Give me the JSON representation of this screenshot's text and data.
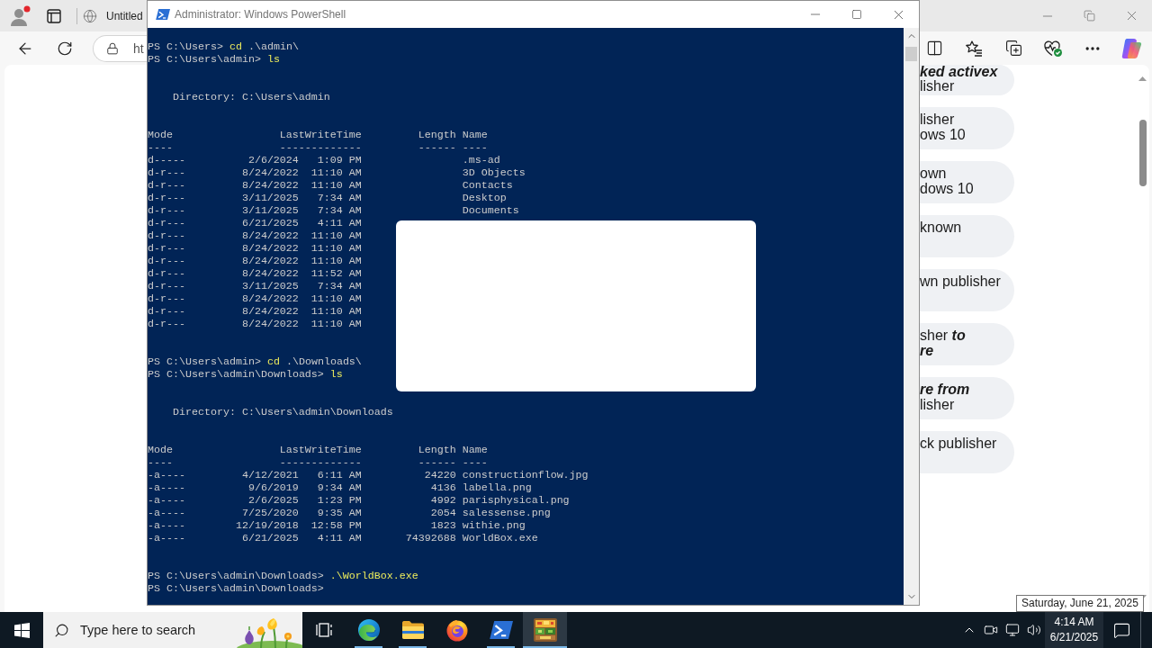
{
  "browser": {
    "tab": {
      "title": "Untitled"
    },
    "address_bar": {
      "value": "ht"
    },
    "page_cards": [
      {
        "text": "**ked activex**\nlisher"
      },
      {
        "text": "lisher\nows 10"
      },
      {
        "text": "own\ndows 10"
      },
      {
        "text": "known"
      },
      {
        "text": "wn publisher"
      },
      {
        "text": "sher **to**\n**re**"
      },
      {
        "text": "**re from**\nlisher"
      },
      {
        "text": "ck publisher"
      }
    ]
  },
  "powershell": {
    "title": "Administrator: Windows PowerShell",
    "blocks": [
      {
        "kind": "command",
        "prompt": "PS C:\\Users>",
        "command": "cd",
        "argument": ".\\admin\\"
      },
      {
        "kind": "command",
        "prompt": "PS C:\\Users\\admin>",
        "command": "ls"
      },
      {
        "kind": "listing",
        "directory": "Directory: C:\\Users\\admin",
        "columns": [
          {
            "heading": "Mode",
            "rule": "----"
          },
          {
            "heading": "LastWriteTime",
            "rule": "-------------"
          },
          {
            "heading": "Length",
            "rule": "------"
          },
          {
            "heading": "Name",
            "rule": "----"
          }
        ],
        "rows": [
          {
            "mode": "d-----",
            "date": "2/6/2024",
            "time": "1:09 PM",
            "name": ".ms-ad"
          },
          {
            "mode": "d-r---",
            "date": "8/24/2022",
            "time": "11:10 AM",
            "name": "3D Objects"
          },
          {
            "mode": "d-r---",
            "date": "8/24/2022",
            "time": "11:10 AM",
            "name": "Contacts"
          },
          {
            "mode": "d-r---",
            "date": "3/11/2025",
            "time": "7:34 AM",
            "name": "Desktop"
          },
          {
            "mode": "d-r---",
            "date": "3/11/2025",
            "time": "7:34 AM",
            "name": "Documents"
          },
          {
            "mode": "d-r---",
            "date": "6/21/2025",
            "time": "4:11 AM"
          },
          {
            "mode": "d-r---",
            "date": "8/24/2022",
            "time": "11:10 AM"
          },
          {
            "mode": "d-r---",
            "date": "8/24/2022",
            "time": "11:10 AM"
          },
          {
            "mode": "d-r---",
            "date": "8/24/2022",
            "time": "11:10 AM"
          },
          {
            "mode": "d-r---",
            "date": "8/24/2022",
            "time": "11:52 AM"
          },
          {
            "mode": "d-r---",
            "date": "3/11/2025",
            "time": "7:34 AM"
          },
          {
            "mode": "d-r---",
            "date": "8/24/2022",
            "time": "11:10 AM"
          },
          {
            "mode": "d-r---",
            "date": "8/24/2022",
            "time": "11:10 AM"
          },
          {
            "mode": "d-r---",
            "date": "8/24/2022",
            "time": "11:10 AM"
          }
        ]
      },
      {
        "kind": "command",
        "prompt": "PS C:\\Users\\admin>",
        "command": "cd",
        "argument": ".\\Downloads\\"
      },
      {
        "kind": "command",
        "prompt": "PS C:\\Users\\admin\\Downloads>",
        "command": "ls"
      },
      {
        "kind": "listing",
        "directory": "Directory: C:\\Users\\admin\\Downloads",
        "columns": [
          {
            "heading": "Mode",
            "rule": "----"
          },
          {
            "heading": "LastWriteTime",
            "rule": "-------------"
          },
          {
            "heading": "Length",
            "rule": "------"
          },
          {
            "heading": "Name",
            "rule": "----"
          }
        ],
        "rows": [
          {
            "mode": "-a----",
            "date": "4/12/2021",
            "time": "6:11 AM",
            "length": "24220",
            "name": "constructionflow.jpg"
          },
          {
            "mode": "-a----",
            "date": "9/6/2019",
            "time": "9:34 AM",
            "length": "4136",
            "name": "labella.png"
          },
          {
            "mode": "-a----",
            "date": "2/6/2025",
            "time": "1:23 PM",
            "length": "4992",
            "name": "parisphysical.png"
          },
          {
            "mode": "-a----",
            "date": "7/25/2020",
            "time": "9:35 AM",
            "length": "2054",
            "name": "salessense.png"
          },
          {
            "mode": "-a----",
            "date": "12/19/2018",
            "time": "12:58 PM",
            "length": "1823",
            "name": "withie.png"
          },
          {
            "mode": "-a----",
            "date": "6/21/2025",
            "time": "4:11 AM",
            "length": "74392688",
            "name": "WorldBox.exe"
          }
        ]
      },
      {
        "kind": "command",
        "prompt": "PS C:\\Users\\admin\\Downloads>",
        "command": ".\\WorldBox.exe"
      },
      {
        "kind": "command",
        "prompt": "PS C:\\Users\\admin\\Downloads>"
      }
    ]
  },
  "taskbar": {
    "search": {
      "placeholder": "Type here to search"
    },
    "apps": [
      {
        "kind": "taskview",
        "running": false,
        "active": false
      },
      {
        "kind": "edge",
        "running": true,
        "active": false
      },
      {
        "kind": "folder",
        "running": true,
        "active": false
      },
      {
        "kind": "firefox",
        "running": false,
        "active": false
      },
      {
        "kind": "terminal",
        "running": true,
        "active": false
      },
      {
        "kind": "game",
        "running": true,
        "active": true
      }
    ],
    "clock": {
      "time": "4:14 AM",
      "date": "6/21/2025",
      "hovered": true,
      "tooltip": "Saturday, June 21, 2025"
    }
  }
}
